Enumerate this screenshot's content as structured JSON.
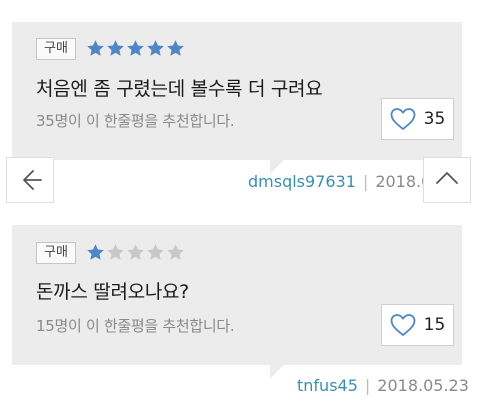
{
  "colors": {
    "card_bg": "#ececec",
    "star_filled": "#4f86c6",
    "star_empty": "#c8c8c8",
    "author": "#3a8fb0",
    "heart": "#4f86c6"
  },
  "reviews": [
    {
      "badge": "구매",
      "rating": 5,
      "rating_max": 5,
      "text": "처음엔 좀 구렸는데 볼수록 더 구려요",
      "recommend_text": "35명이 이 한줄평을 추천합니다.",
      "likes": "35",
      "author": "dmsqls97631",
      "date": "2018.0"
    },
    {
      "badge": "구매",
      "rating": 1,
      "rating_max": 5,
      "text": "돈까스 딸려오나요?",
      "recommend_text": "15명이 이 한줄평을 추천합니다.",
      "likes": "15",
      "author": "tnfus45",
      "date": "2018.05.23"
    }
  ],
  "nav": {
    "back_icon": "arrow-left-icon",
    "top_icon": "arrow-up-icon"
  }
}
